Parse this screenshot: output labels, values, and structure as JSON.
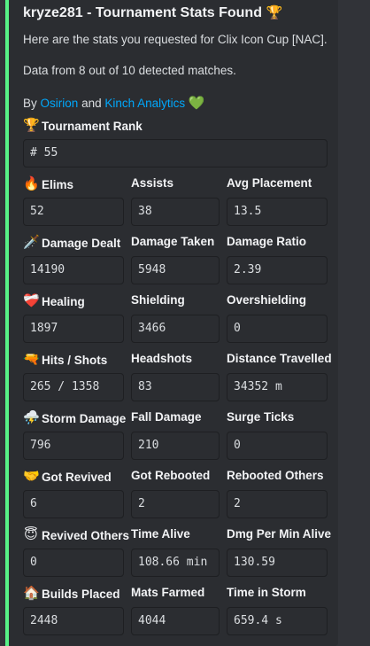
{
  "embed": {
    "title_text": "kryze281 - Tournament Stats Found",
    "title_emoji": "🏆",
    "line1": "Here are the stats you requested for Clix Icon Cup [NAC].",
    "line2": "Data from 8 out of 10 detected matches.",
    "credit": {
      "by": "By",
      "author1": "Osirion",
      "and": "and",
      "author2": "Kinch Analytics",
      "emoji": "💚"
    },
    "accent_color": "#57f287",
    "link_color": "#00a8fc"
  },
  "rank": {
    "emoji": "🏆",
    "name": "Tournament Rank",
    "value": "# 55"
  },
  "rows": [
    [
      {
        "emoji": "🔥",
        "name": "Elims",
        "value": "52"
      },
      {
        "name": "Assists",
        "value": "38"
      },
      {
        "name": "Avg Placement",
        "value": "13.5"
      }
    ],
    [
      {
        "emoji": "🗡️",
        "name": "Damage Dealt",
        "value": "14190"
      },
      {
        "name": "Damage Taken",
        "value": "5948"
      },
      {
        "name": "Damage Ratio",
        "value": "2.39"
      }
    ],
    [
      {
        "emoji": "❤️‍🩹",
        "name": "Healing",
        "value": "1897"
      },
      {
        "name": "Shielding",
        "value": "3466"
      },
      {
        "name": "Overshielding",
        "value": "0"
      }
    ],
    [
      {
        "emoji": "🔫",
        "name": "Hits / Shots",
        "value": "265 / 1358"
      },
      {
        "name": "Headshots",
        "value": "83"
      },
      {
        "name": "Distance Travelled",
        "value": "34352 m"
      }
    ],
    [
      {
        "emoji": "⛈️",
        "name": "Storm Damage",
        "value": "796"
      },
      {
        "name": "Fall Damage",
        "value": "210"
      },
      {
        "name": "Surge Ticks",
        "value": "0"
      }
    ],
    [
      {
        "emoji": "🤝",
        "name": "Got Revived",
        "value": "6"
      },
      {
        "name": "Got Rebooted",
        "value": "2"
      },
      {
        "name": "Rebooted Others",
        "value": "2"
      }
    ],
    [
      {
        "emoji": "😇",
        "name": "Revived Others",
        "value": "0"
      },
      {
        "name": "Time Alive",
        "value": "108.66 min"
      },
      {
        "name": "Dmg Per Min Alive",
        "value": "130.59"
      }
    ],
    [
      {
        "emoji": "🏠",
        "name": "Builds Placed",
        "value": "2448"
      },
      {
        "name": "Mats Farmed",
        "value": "4044"
      },
      {
        "name": "Time in Storm",
        "value": "659.4 s"
      }
    ]
  ]
}
